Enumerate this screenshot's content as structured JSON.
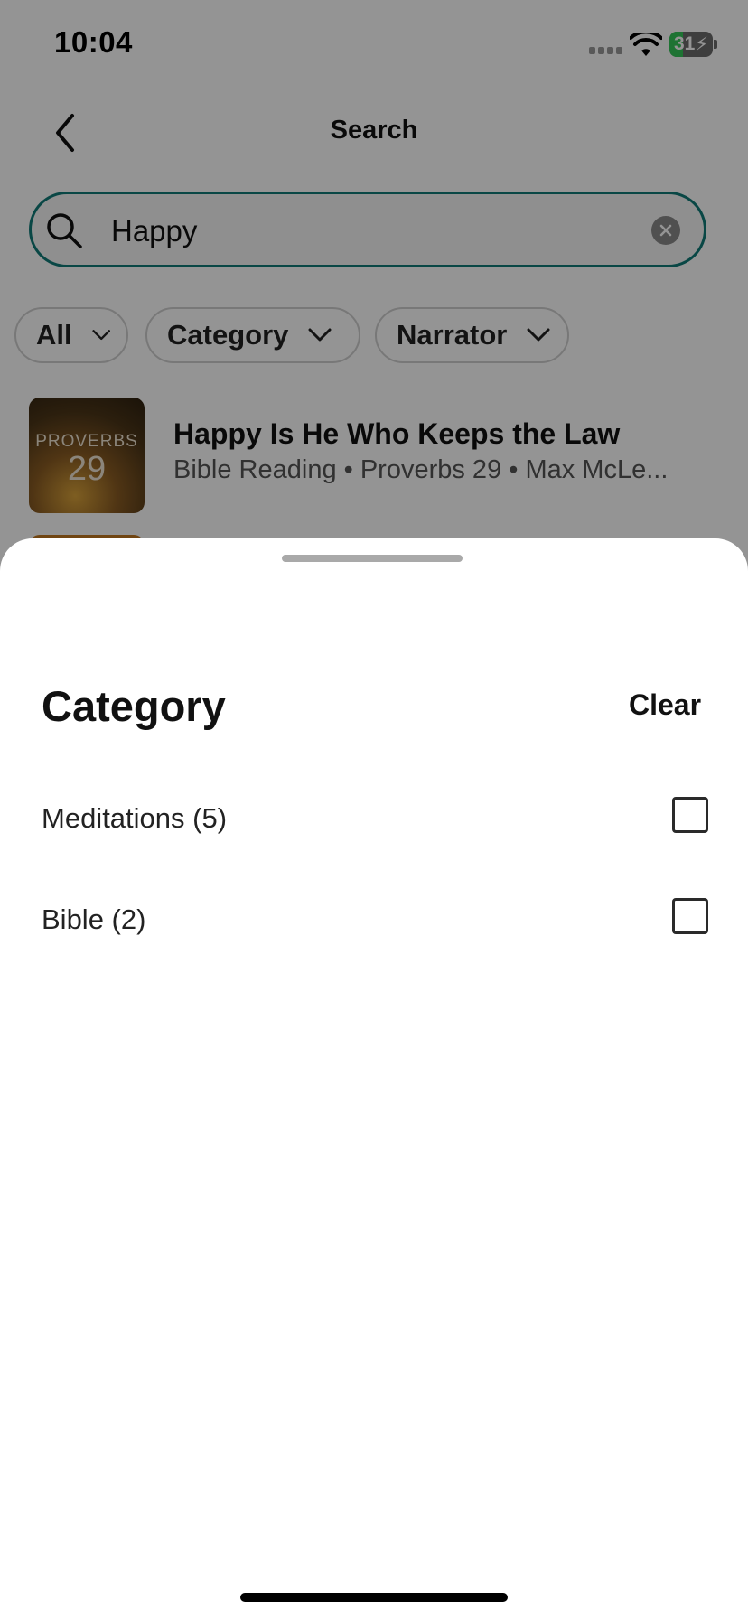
{
  "status_bar": {
    "time": "10:04",
    "battery_level": "31",
    "battery_fraction": 0.31,
    "battery_color": "#34c759",
    "icons": [
      "signal-icon",
      "wifi-icon",
      "battery-charging-icon"
    ]
  },
  "nav": {
    "back_icon": "chevron-left-icon",
    "title": "Search"
  },
  "search": {
    "value": "Happy",
    "icon": "search-icon",
    "clear_icon": "clear-circle-icon",
    "border_color": "#117a78"
  },
  "filters": [
    {
      "label": "All",
      "icon": "chevron-down-icon"
    },
    {
      "label": "Category",
      "icon": "chevron-down-icon"
    },
    {
      "label": "Narrator",
      "icon": "chevron-down-icon"
    }
  ],
  "results": [
    {
      "thumbnail_word": "PROVERBS",
      "thumbnail_number": "29",
      "title": "Happy Is He Who Keeps the Law",
      "subtitle": "Bible Reading • Proverbs 29 • Max McLe..."
    }
  ],
  "sheet": {
    "title": "Category",
    "clear_label": "Clear",
    "options": [
      {
        "label": "Meditations (5)",
        "checked": false
      },
      {
        "label": "Bible (2)",
        "checked": false
      }
    ]
  }
}
